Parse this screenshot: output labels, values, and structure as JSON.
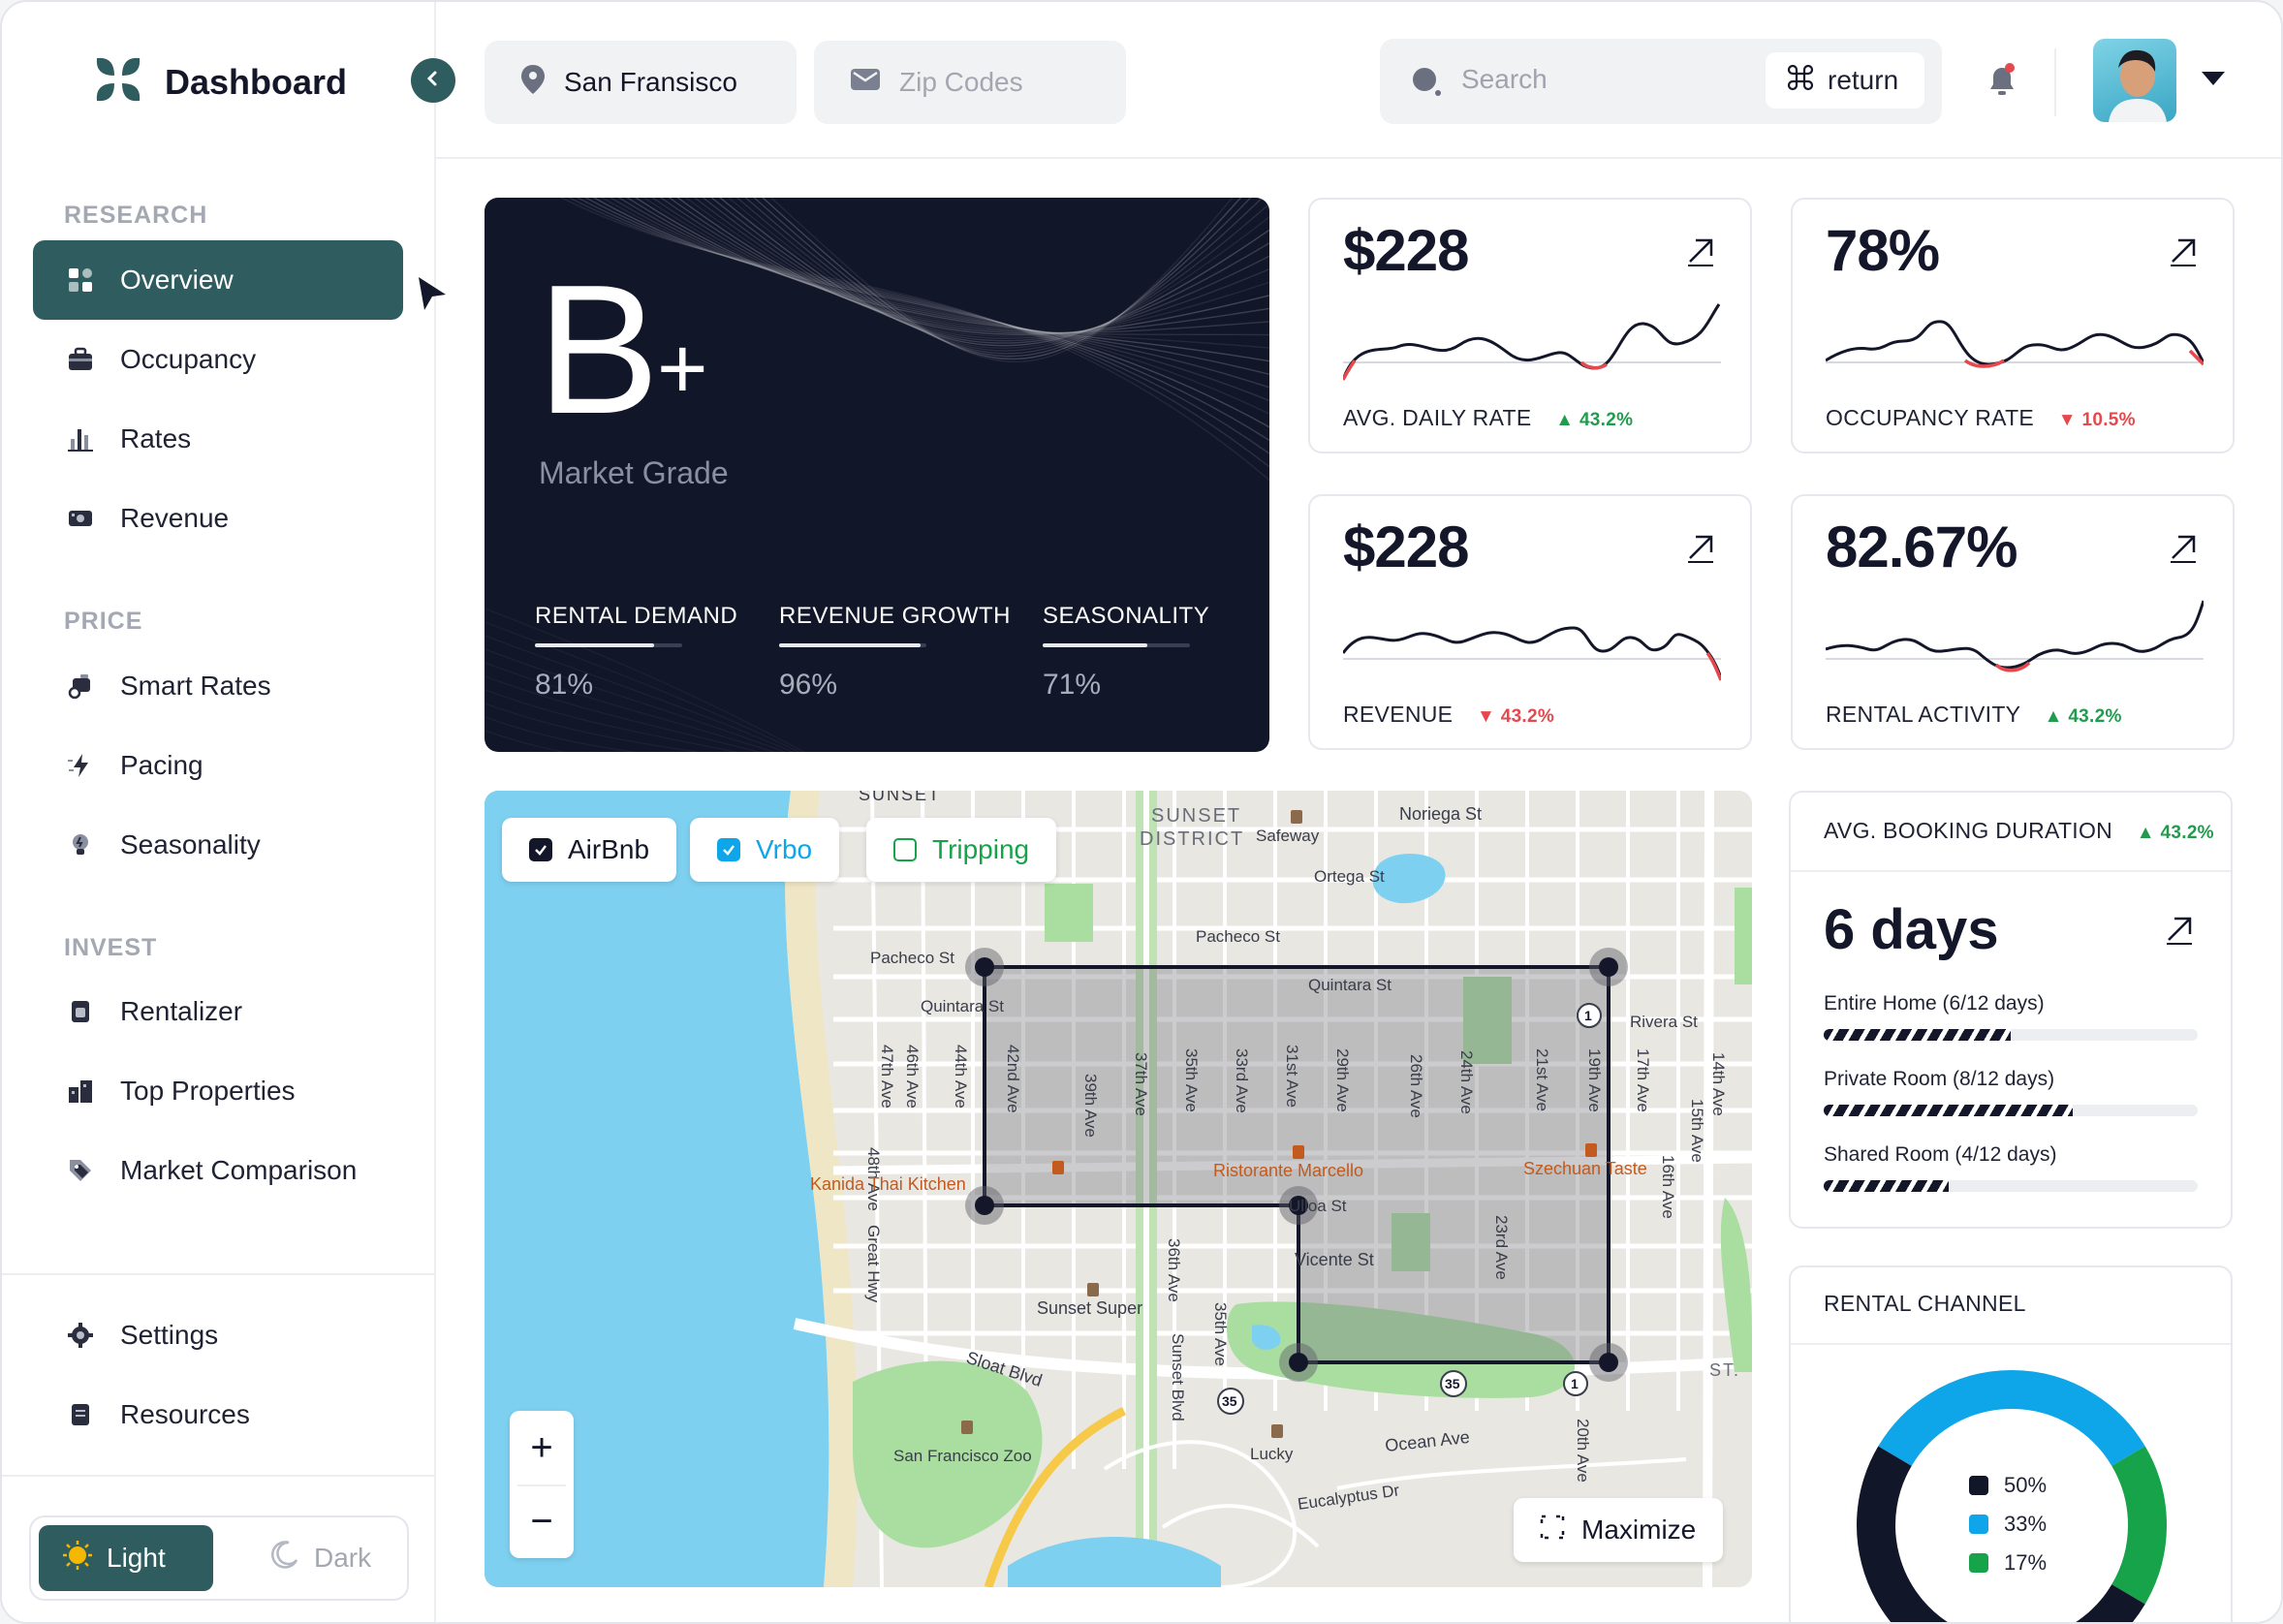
{
  "app": {
    "title": "Dashboard"
  },
  "topbar": {
    "location": "San Fransisco",
    "zip_placeholder": "Zip Codes",
    "search_placeholder": "Search",
    "shortcut_label": "return"
  },
  "sidebar": {
    "sections": [
      {
        "label": "RESEARCH",
        "items": [
          {
            "label": "Overview",
            "icon": "grid-icon"
          },
          {
            "label": "Occupancy",
            "icon": "briefcase-icon"
          },
          {
            "label": "Rates",
            "icon": "bar-chart-icon"
          },
          {
            "label": "Revenue",
            "icon": "cash-icon"
          }
        ]
      },
      {
        "label": "PRICE",
        "items": [
          {
            "label": "Smart Rates",
            "icon": "dollar-truck-icon"
          },
          {
            "label": "Pacing",
            "icon": "lightning-icon"
          },
          {
            "label": "Seasonality",
            "icon": "bulb-icon"
          }
        ]
      },
      {
        "label": "INVEST",
        "items": [
          {
            "label": "Rentalizer",
            "icon": "calculator-icon"
          },
          {
            "label": "Top Properties",
            "icon": "building-icon"
          },
          {
            "label": "Market Comparison",
            "icon": "tag-icon"
          }
        ]
      }
    ],
    "footer": [
      {
        "label": "Settings",
        "icon": "gear-icon"
      },
      {
        "label": "Resources",
        "icon": "document-icon"
      }
    ],
    "theme": {
      "light": "Light",
      "dark": "Dark",
      "selected": "Light"
    }
  },
  "grade": {
    "value": "B",
    "modifier": "+",
    "label": "Market Grade",
    "metrics": [
      {
        "label": "RENTAL DEMAND",
        "value": "81%",
        "fill": 0.81
      },
      {
        "label": "REVENUE GROWTH",
        "value": "96%",
        "fill": 0.96
      },
      {
        "label": "SEASONALITY",
        "value": "71%",
        "fill": 0.71
      }
    ]
  },
  "stats": [
    {
      "value": "$228",
      "label": "AVG. DAILY RATE",
      "delta": "43.2%",
      "direction": "up"
    },
    {
      "value": "78%",
      "label": "OCCUPANCY RATE",
      "delta": "10.5%",
      "direction": "down"
    },
    {
      "value": "$228",
      "label": "REVENUE",
      "delta": "43.2%",
      "direction": "down"
    },
    {
      "value": "82.67%",
      "label": "RENTAL ACTIVITY",
      "delta": "43.2%",
      "direction": "up"
    }
  ],
  "map": {
    "filters": [
      {
        "label": "AirBnb",
        "checked": true,
        "color": "#14172a"
      },
      {
        "label": "Vrbo",
        "checked": true,
        "color": "#0ea5e9"
      },
      {
        "label": "Tripping",
        "checked": false,
        "color": "#16a34a"
      }
    ],
    "labels": {
      "district": "SUNSET",
      "district2": "DISTRICT",
      "noriega": "Noriega St",
      "safeway": "Safeway",
      "ortega": "Ortega St",
      "pacheco": "Pacheco St",
      "pacheco2": "Pacheco St",
      "quintara": "Quintara St",
      "quintara2": "Quintara St",
      "rivera": "Rivera St",
      "ave47": "47th Ave",
      "ave46": "46th Ave",
      "ave44": "44th Ave",
      "ave42": "42nd Ave",
      "ave39": "39th Ave",
      "ave37": "37th Ave",
      "ave35": "35th Ave",
      "ave33": "33rd Ave",
      "ave31": "31st Ave",
      "ave29": "29th Ave",
      "ave26": "26th Ave",
      "ave24": "24th Ave",
      "ave21": "21st Ave",
      "ave19": "19th Ave",
      "ave17": "17th Ave",
      "ave15": "15th Ave",
      "ave14": "14th Ave",
      "ave16": "16th Ave",
      "ave48": "48th Ave",
      "greathwy": "Great Hwy",
      "ave36": "36th Ave",
      "ave35b": "35th Ave",
      "ave23": "23rd Ave",
      "ave20": "20th Ave",
      "ulloa": "Ulloa St",
      "vicente": "Vicente St",
      "sloat": "Sloat Blvd",
      "sunsetblvd": "Sunset Blvd",
      "ocean": "Ocean Ave",
      "eucalyptus": "Eucalyptus Dr",
      "st": "ST.",
      "zoo": "San Francisco Zoo",
      "lucky": "Lucky",
      "sunsetsuper": "Sunset Super",
      "thai": "Kanida Thai Kitchen",
      "marcello": "Ristorante Marcello",
      "szechuan": "Szechuan Taste",
      "r35": "35",
      "r35b": "35",
      "r1": "1",
      "r1b": "1"
    },
    "zoom_in": "+",
    "zoom_out": "−",
    "maximize": "Maximize"
  },
  "booking": {
    "title": "AVG. BOOKING DURATION",
    "delta": "43.2%",
    "direction": "up",
    "value": "6 days",
    "rows": [
      {
        "label": "Entire Home (6/12 days)",
        "fraction": 0.5
      },
      {
        "label": "Private Room (8/12 days)",
        "fraction": 0.667
      },
      {
        "label": "Shared Room (4/12 days)",
        "fraction": 0.333
      }
    ]
  },
  "channel": {
    "title": "RENTAL CHANNEL",
    "slices": [
      {
        "label": "50%",
        "value": 50,
        "color": "#121629"
      },
      {
        "label": "33%",
        "value": 33,
        "color": "#0ea5e9"
      },
      {
        "label": "17%",
        "value": 17,
        "color": "#16a34a"
      }
    ]
  },
  "colors": {
    "accent": "#2f5c5f",
    "navy": "#121629",
    "up": "#239b4f",
    "down": "#e5484d"
  }
}
